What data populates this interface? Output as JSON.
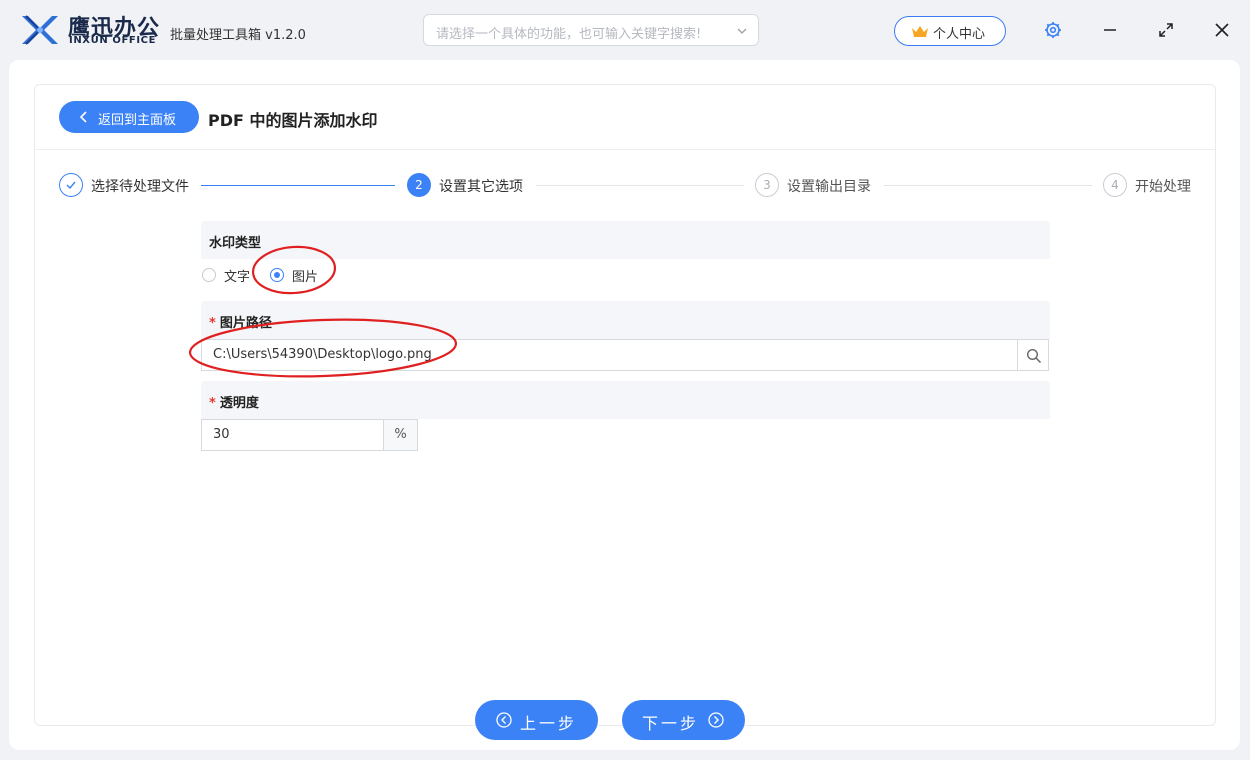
{
  "brand": {
    "name_cn": "鹰迅办公",
    "name_en": "INXUN OFFICE",
    "app_title": "批量处理工具箱 v1.2.0"
  },
  "search": {
    "placeholder": "请选择一个具体的功能，也可输入关键字搜索!"
  },
  "header": {
    "personal_center": "个人中心"
  },
  "colors": {
    "accent": "#3b82f6",
    "required": "#e53935",
    "annotation": "#e02020"
  },
  "page": {
    "back_label": "返回到主面板",
    "title": "PDF 中的图片添加水印"
  },
  "steps": [
    {
      "number": "1",
      "label": "选择待处理文件",
      "state": "done"
    },
    {
      "number": "2",
      "label": "设置其它选项",
      "state": "active"
    },
    {
      "number": "3",
      "label": "设置输出目录",
      "state": "pending"
    },
    {
      "number": "4",
      "label": "开始处理",
      "state": "pending"
    }
  ],
  "form": {
    "watermark_type": {
      "label": "水印类型",
      "options": [
        "文字",
        "图片"
      ],
      "selected": "图片"
    },
    "image_path": {
      "required_mark": "*",
      "label": "图片路径",
      "value": "C:\\Users\\54390\\Desktop\\logo.png"
    },
    "opacity": {
      "required_mark": "*",
      "label": "透明度",
      "value": "30",
      "unit": "%"
    }
  },
  "footer": {
    "prev_label": "上一步",
    "next_label": "下一步"
  }
}
